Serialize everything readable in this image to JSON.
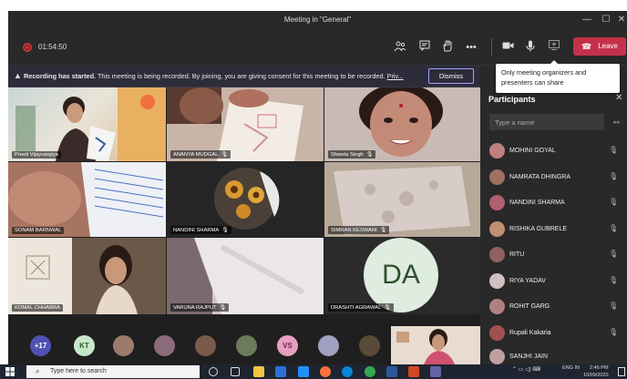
{
  "window": {
    "title": "Meeting in \"General\"",
    "controls": {
      "minimize": "—",
      "maximize": "☐",
      "close": "✕"
    }
  },
  "toolbar": {
    "timer": "01:54:50",
    "icons": [
      "people-icon",
      "chat-icon",
      "raise-hand-icon",
      "more-icon",
      "camera-icon",
      "mic-icon",
      "share-tray-icon"
    ],
    "leave_label": "Leave"
  },
  "banner": {
    "bold": "Recording has started.",
    "text": " This meeting is being recorded. By joining, you are giving consent for this meeting to be recorded. ",
    "link": "Priv...",
    "dismiss_label": "Dismiss"
  },
  "tooltip": {
    "text": "Only meeting organizers and presenters can share"
  },
  "tiles": [
    {
      "name": "Preeti Vijayvargiya",
      "mic": ""
    },
    {
      "name": "ANANYA MUDGAL",
      "mic": "🎙"
    },
    {
      "name": "Shweta Singh",
      "mic": "🎙"
    },
    {
      "name": "SONAM BARNWAL",
      "mic": ""
    },
    {
      "name": "NANDINI SHARMA",
      "mic": "🎙"
    },
    {
      "name": "SIMRAN KESWANI",
      "mic": "🎙"
    },
    {
      "name": "KOMAL CHHABRA",
      "mic": ""
    },
    {
      "name": "VARUNA RAJPUT",
      "mic": "🎙"
    },
    {
      "name": "DRASHTI AGRAWAL",
      "mic": "🎙"
    }
  ],
  "da_initials": "DA",
  "participants": {
    "title": "Participants",
    "search_placeholder": "Type a name",
    "list": [
      {
        "name": "MOHINI GOYAL",
        "color": "#c08080"
      },
      {
        "name": "NAMRATA DHINGRA",
        "color": "#a07060"
      },
      {
        "name": "NANDINI SHARMA",
        "color": "#b06070"
      },
      {
        "name": "RISHIKA GUBRELE",
        "color": "#c09070"
      },
      {
        "name": "RITU",
        "color": "#906060"
      },
      {
        "name": "RIYA YADAV",
        "color": "#d0c0c0"
      },
      {
        "name": "ROHIT GARG",
        "color": "#b08080"
      },
      {
        "name": "Rupali Kakaria",
        "color": "#a05050"
      },
      {
        "name": "SANJHI JAIN",
        "color": "#c0a0a0"
      }
    ]
  },
  "strip": [
    {
      "label": "+17",
      "bg": "#4f52b2",
      "fg": "#fff"
    },
    {
      "label": "KT",
      "bg": "#c8e6c9",
      "fg": "#2e5e2e"
    },
    {
      "label": "",
      "bg": "#9b7b6b",
      "fg": "#fff"
    },
    {
      "label": "",
      "bg": "#8b6b7b",
      "fg": "#fff"
    },
    {
      "label": "",
      "bg": "#7a5a4a",
      "fg": "#fff"
    },
    {
      "label": "",
      "bg": "#6b7b5b",
      "fg": "#fff"
    },
    {
      "label": "VS",
      "bg": "#e8a0c0",
      "fg": "#7a2050"
    },
    {
      "label": "",
      "bg": "#a0a0c0",
      "fg": "#fff"
    },
    {
      "label": "",
      "bg": "#5a4a3a",
      "fg": "#fff"
    }
  ],
  "taskbar": {
    "search_placeholder": "Type here to search",
    "lang": "ENG IN",
    "time": "2:46 PM",
    "date": "10/09/2020"
  }
}
